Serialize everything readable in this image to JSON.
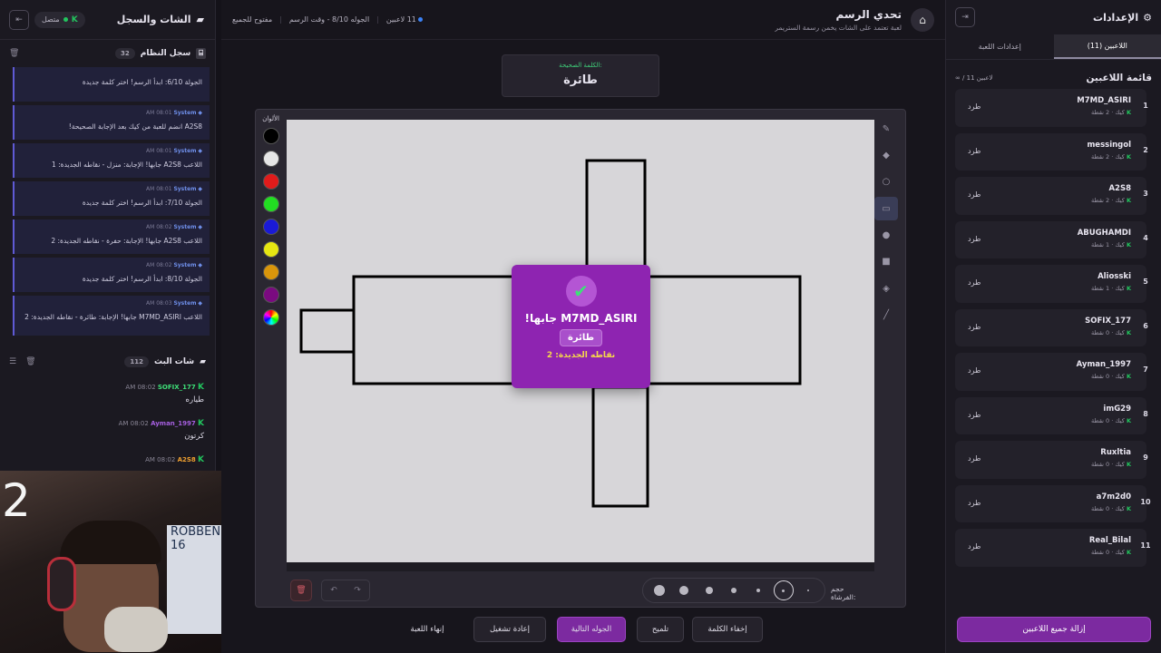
{
  "left": {
    "title": "الشات والسجل",
    "online": "متصل",
    "log_title": "سجل النظام",
    "log_count": "32",
    "log": [
      {
        "who": "",
        "time": "",
        "text": "الجولة 6/10: ابدأ الرسم! اختر كلمة جديدة"
      },
      {
        "who": "System",
        "time": "AM 08:01",
        "text": "A2S8 انضم للعبة من كيك بعد الإجابة الصحيحة!"
      },
      {
        "who": "System",
        "time": "AM 08:01",
        "text": "اللاعب A2S8 جابها! الإجابة: منزل - نقاطه الجديدة: 1"
      },
      {
        "who": "System",
        "time": "AM 08:01",
        "text": "الجولة 7/10: ابدأ الرسم! اختر كلمة جديدة"
      },
      {
        "who": "System",
        "time": "AM 08:02",
        "text": "اللاعب A2S8 جابها! الإجابة: حفرة - نقاطه الجديدة: 2"
      },
      {
        "who": "System",
        "time": "AM 08:02",
        "text": "الجولة 8/10: ابدأ الرسم! اختر كلمة جديدة"
      },
      {
        "who": "System",
        "time": "AM 08:03",
        "text": "اللاعب M7MD_ASIRI جابها! الإجابة: طائرة - نقاطه الجديدة: 2"
      }
    ],
    "stream_title": "شات البث",
    "stream_count": "112",
    "chat": [
      {
        "name": "SOFIX_177",
        "color": "#3ee078",
        "time": "AM 08:02",
        "text": "طياره"
      },
      {
        "name": "Ayman_1997",
        "color": "#a65fe0",
        "time": "AM 08:02",
        "text": "كرتون"
      },
      {
        "name": "A2S8",
        "color": "#f0a030",
        "time": "AM 08:02",
        "text": ""
      }
    ],
    "cam_number": "2",
    "cam_jersey": "ROBBEN 16"
  },
  "top": {
    "title": "تحدي الرسم",
    "subtitle": "لعبة تعتمد على الشات يخمن رسمة الستريمر",
    "players": "11 لاعبين",
    "round": "الجوله 8/10 - وقت الرسم",
    "open": "مفتوح للجميع"
  },
  "word": {
    "label": "الكلمة الصحيحة:",
    "value": "طائرة"
  },
  "board": {
    "colors_label": "الألوان",
    "size_label": "حجم الفرشاة:",
    "palette": [
      "#000000",
      "#e6e6e6",
      "#e01b1b",
      "#22dd22",
      "#1a1ad6",
      "#e6e612",
      "#d9950b",
      "#7a0a80"
    ]
  },
  "popup": {
    "title": "M7MD_ASIRI جابها!",
    "word": "طائرة",
    "points": "نقاطه الجديدة: 2"
  },
  "actions": {
    "hide_word": "إخفاء الكلمة",
    "hint": "تلميح",
    "next_round": "الجوله التالية",
    "restart": "إعادة تشغيل",
    "end_game": "إنهاء اللعبة"
  },
  "right": {
    "title": "الإعدادات",
    "tab_players": "اللاعبين (11)",
    "tab_settings": "إعدادات اللعبة",
    "list_title": "قائمة اللاعبين",
    "list_count": "∞ / 11 لاعبين",
    "kick": "طرد",
    "players": [
      {
        "rank": "1",
        "name": "M7MD_ASIRI",
        "points": "2 نقطة"
      },
      {
        "rank": "2",
        "name": "messingol",
        "points": "2 نقطة"
      },
      {
        "rank": "3",
        "name": "A2S8",
        "points": "2 نقطة"
      },
      {
        "rank": "4",
        "name": "ABUGHAMDI",
        "points": "1 نقطة"
      },
      {
        "rank": "5",
        "name": "Aliosski",
        "points": "1 نقطة"
      },
      {
        "rank": "6",
        "name": "SOFIX_177",
        "points": "0 نقطة"
      },
      {
        "rank": "7",
        "name": "Ayman_1997",
        "points": "0 نقطة"
      },
      {
        "rank": "8",
        "name": "imG29",
        "points": "0 نقطة"
      },
      {
        "rank": "9",
        "name": "Ruxltia",
        "points": "0 نقطة"
      },
      {
        "rank": "10",
        "name": "a7m2d0",
        "points": "0 نقطة"
      },
      {
        "rank": "11",
        "name": "Real_Bilal",
        "points": "0 نقطة"
      }
    ],
    "platform": "كيك",
    "remove_all": "إزالة جميع اللاعبين"
  }
}
